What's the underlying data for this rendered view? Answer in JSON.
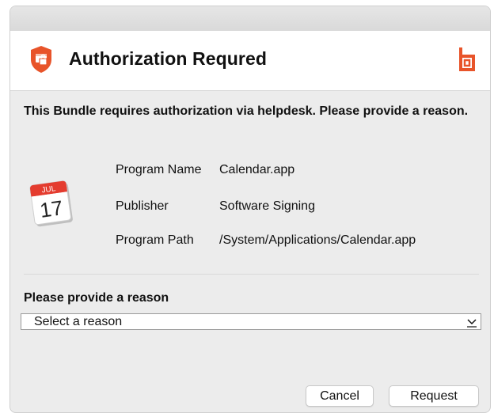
{
  "dialog": {
    "title": "Authorization Requred",
    "prompt": "This Bundle requires authorization via helpdesk. Please provide a reason.",
    "icons": {
      "header": "shield-lock-icon",
      "brand": "brand-logo-icon",
      "app": "calendar-app-icon"
    }
  },
  "app_icon": {
    "month": "JUL",
    "day": "17"
  },
  "program": {
    "rows": [
      {
        "label": "Program Name",
        "value": "Calendar.app"
      },
      {
        "label": "Publisher",
        "value": "Software Signing"
      },
      {
        "label": "Program Path",
        "value": "/System/Applications/Calendar.app"
      }
    ]
  },
  "reason": {
    "label": "Please provide a reason",
    "selected": "Select a reason"
  },
  "buttons": {
    "cancel": "Cancel",
    "request": "Request"
  },
  "colors": {
    "accent": "#e8542a",
    "window_bg": "#ececec",
    "header_bg": "#ffffff"
  }
}
